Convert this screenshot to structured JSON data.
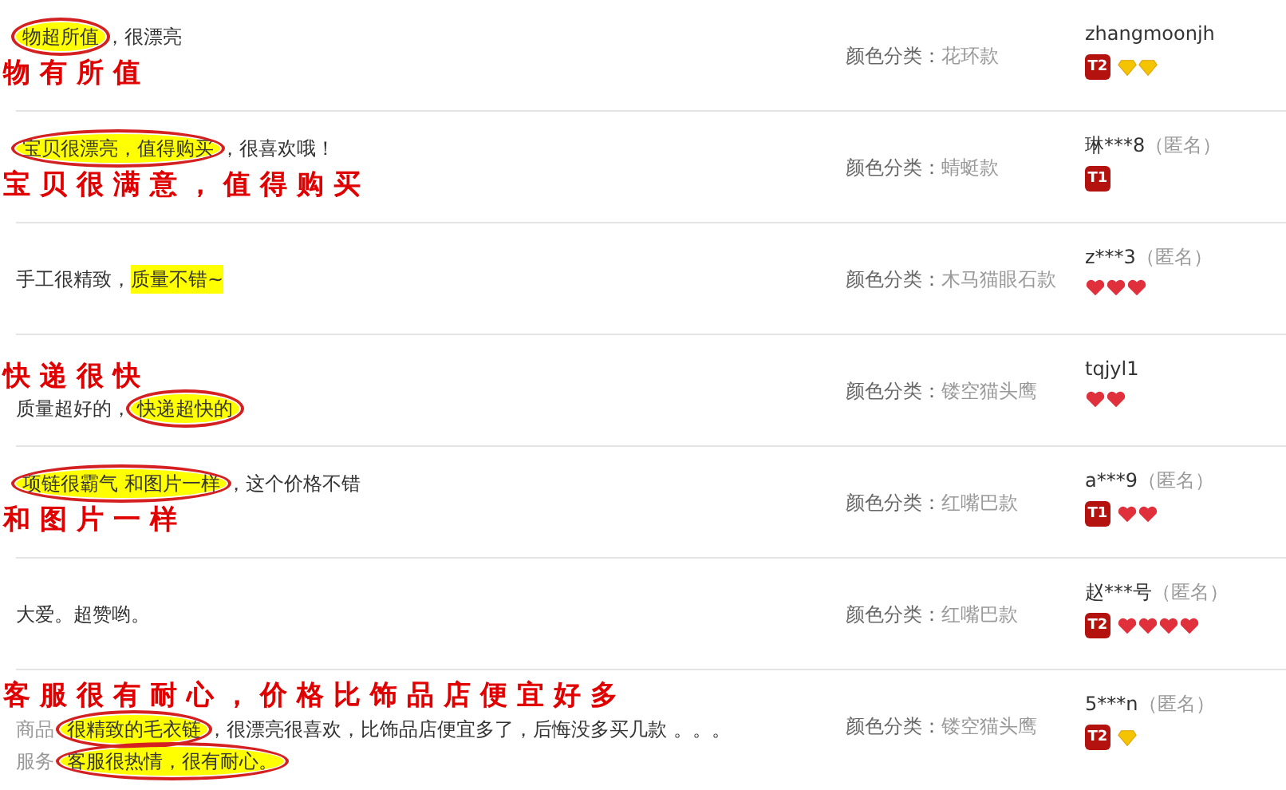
{
  "reviews": [
    {
      "comment": [
        {
          "segments": [
            {
              "text": "物超所值",
              "highlighted": true,
              "circled": true
            },
            {
              "text": "，很漂亮",
              "highlighted": false,
              "circled": false
            }
          ]
        }
      ],
      "annotation": {
        "text": "物有所值",
        "kind": "below"
      },
      "variant": {
        "label": "颜色分类：",
        "value": "花环款"
      },
      "user": {
        "name": "zhangmoonjh",
        "level_badge": "T2",
        "rank": [
          {
            "kind": "diamond"
          },
          {
            "kind": "diamond"
          }
        ]
      }
    },
    {
      "comment": [
        {
          "segments": [
            {
              "text": "宝贝很漂亮，值得购买",
              "highlighted": true,
              "circled": true
            },
            {
              "text": "，很喜欢哦！",
              "highlighted": false,
              "circled": false
            }
          ]
        }
      ],
      "annotation": {
        "text": "宝贝很满意，值得购买",
        "kind": "below"
      },
      "variant": {
        "label": "颜色分类：",
        "value": "蜻蜓款"
      },
      "user": {
        "name": "琳***8",
        "tag": "（匿名）",
        "level_badge": "T1"
      }
    },
    {
      "comment": [
        {
          "segments": [
            {
              "text": "手工很精致，",
              "highlighted": false,
              "circled": false
            },
            {
              "text": "质量不错~",
              "highlighted": true,
              "circled": false
            }
          ]
        }
      ],
      "variant": {
        "label": "颜色分类：",
        "value": "木马猫眼石款"
      },
      "user": {
        "name": "z***3",
        "tag": "（匿名）",
        "rank": [
          {
            "kind": "heart"
          },
          {
            "kind": "heart"
          },
          {
            "kind": "heart"
          }
        ]
      }
    },
    {
      "comment": [
        {
          "segments": [
            {
              "text": "质量超好的，",
              "highlighted": false,
              "circled": false
            },
            {
              "text": "快递超快的",
              "highlighted": true,
              "circled": true
            }
          ]
        }
      ],
      "annotation": {
        "text": "快递很快",
        "kind": "above"
      },
      "variant": {
        "label": "颜色分类：",
        "value": "镂空猫头鹰"
      },
      "user": {
        "name": "tqjyl1",
        "rank": [
          {
            "kind": "heart"
          },
          {
            "kind": "heart"
          }
        ]
      }
    },
    {
      "comment": [
        {
          "segments": [
            {
              "text": "项链很霸气 和图片一样",
              "highlighted": true,
              "circled": true
            },
            {
              "text": "，这个价格不错",
              "highlighted": false,
              "circled": false
            }
          ]
        }
      ],
      "annotation": {
        "text": "和图片一样",
        "kind": "below"
      },
      "variant": {
        "label": "颜色分类：",
        "value": "红嘴巴款"
      },
      "user": {
        "name": "a***9",
        "tag": "（匿名）",
        "level_badge": "T1",
        "rank": [
          {
            "kind": "heart"
          },
          {
            "kind": "heart"
          }
        ]
      }
    },
    {
      "comment": [
        {
          "segments": [
            {
              "text": "大爱。超赞哟。",
              "highlighted": false,
              "circled": false
            }
          ]
        }
      ],
      "variant": {
        "label": "颜色分类：",
        "value": "红嘴巴款"
      },
      "user": {
        "name": "赵***号",
        "tag": "（匿名）",
        "level_badge": "T2",
        "rank": [
          {
            "kind": "heart"
          },
          {
            "kind": "heart"
          },
          {
            "kind": "heart"
          },
          {
            "kind": "heart"
          }
        ]
      }
    },
    {
      "comment": [
        {
          "label": "商品",
          "segments": [
            {
              "text": "很精致的毛衣链",
              "highlighted": true,
              "circled": true
            },
            {
              "text": "，很漂亮很喜欢，比饰品店便宜多了，后悔没多买几款 。。。",
              "highlighted": false,
              "circled": false
            }
          ]
        },
        {
          "label": "服务",
          "segments": [
            {
              "text": "客服很热情，很有耐心。",
              "highlighted": true,
              "circled": true
            }
          ]
        }
      ],
      "annotation": {
        "text": "客服很有耐心，价格比饰品店便宜好多",
        "kind": "above"
      },
      "variant": {
        "label": "颜色分类：",
        "value": "镂空猫头鹰"
      },
      "user": {
        "name": "5***n",
        "tag": "（匿名）",
        "level_badge": "T2",
        "rank": [
          {
            "kind": "diamond"
          }
        ]
      }
    }
  ]
}
